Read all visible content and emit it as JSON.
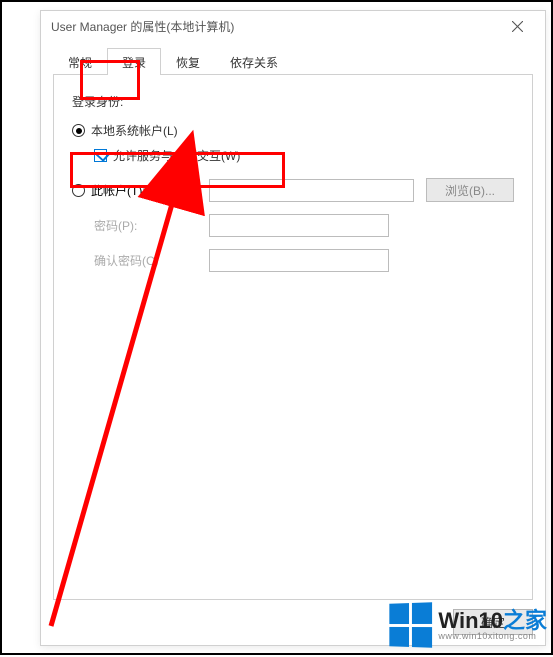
{
  "window": {
    "title": "User Manager 的属性(本地计算机)"
  },
  "tabs": {
    "items": [
      {
        "label": "常规"
      },
      {
        "label": "登录"
      },
      {
        "label": "恢复"
      },
      {
        "label": "依存关系"
      }
    ],
    "active_index": 1
  },
  "logon": {
    "section_label": "登录身份:",
    "local_system": {
      "label": "本地系统帐户(L)",
      "selected": true,
      "allow_interact": {
        "label": "允许服务与桌面交互(W)",
        "checked": true
      }
    },
    "this_account": {
      "label": "此帐户(T):",
      "selected": false,
      "value": "",
      "browse_label": "浏览(B)...",
      "password_label": "密码(P):",
      "password_value": "",
      "confirm_label": "确认密码(C)",
      "confirm_value": ""
    }
  },
  "buttons": {
    "ok": "确定"
  },
  "watermark": {
    "main_a": "Win10",
    "main_b": "之家",
    "sub": "www.win10xitong.com"
  }
}
